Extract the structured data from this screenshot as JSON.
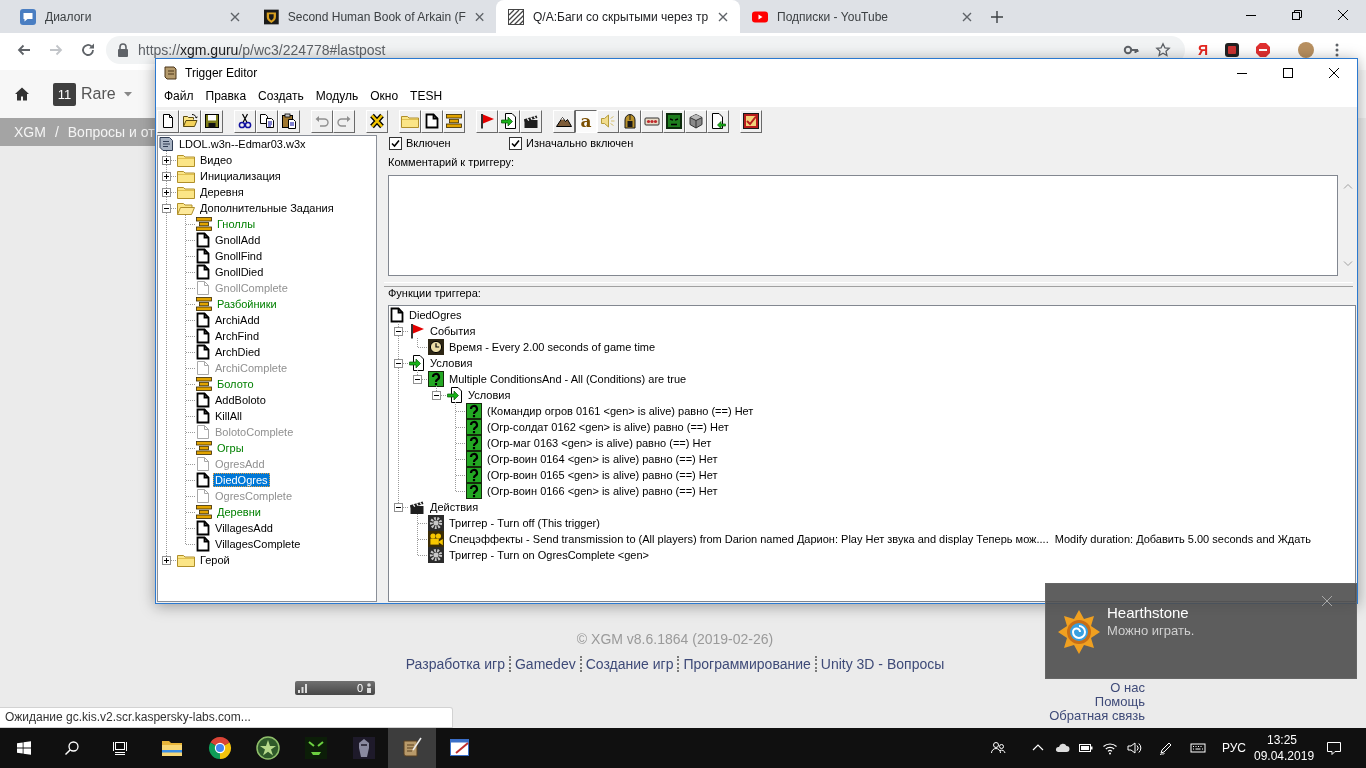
{
  "browser": {
    "tabs": [
      {
        "kind": "chat",
        "title": "Диалоги",
        "selected": false
      },
      {
        "kind": "shield",
        "title": "Second Human Book of Arkain (F",
        "selected": false
      },
      {
        "kind": "hatch",
        "title": "Q/A:Баги со скрытыми через тр",
        "selected": true
      },
      {
        "kind": "play",
        "title": "Подписки - YouTube",
        "selected": false
      }
    ],
    "address": {
      "scheme": "https://",
      "host": "xgm.guru",
      "path": "/p/wc3/224778#lastpost"
    },
    "extension_glyph": "Я"
  },
  "page": {
    "header": {
      "badge": "11",
      "rank": "Rare"
    },
    "breadcrumb": {
      "items": [
        "XGM",
        "Вопросы и от"
      ],
      "separator": "/"
    },
    "footer": {
      "copyright": "© XGM v8.6.1864 (2019-02-26)",
      "links": [
        "Разработка игр",
        "Gamedev",
        "Создание игр",
        "Программирование",
        "Unity 3D - Вопросы"
      ]
    },
    "counter": "0",
    "side_links": [
      "О нас",
      "Помощь",
      "Обратная связь"
    ],
    "status": "Ожидание gc.kis.v2.scr.kaspersky-labs.com..."
  },
  "trigger_editor": {
    "title": "Trigger Editor",
    "menu": [
      "Файл",
      "Правка",
      "Создать",
      "Модуль",
      "Окно",
      "TESH"
    ],
    "toolbar": [
      [
        {
          "kind": "new",
          "disabled": false,
          "pressed": false
        },
        {
          "kind": "open",
          "disabled": false,
          "pressed": false
        },
        {
          "kind": "save",
          "disabled": false,
          "pressed": false
        }
      ],
      [
        {
          "kind": "cut",
          "disabled": false,
          "pressed": false
        },
        {
          "kind": "copy",
          "disabled": false,
          "pressed": false
        },
        {
          "kind": "paste",
          "disabled": false,
          "pressed": false
        }
      ],
      [
        {
          "kind": "undo",
          "disabled": true,
          "pressed": false
        },
        {
          "kind": "redo",
          "disabled": true,
          "pressed": false
        }
      ],
      [
        {
          "kind": "delete",
          "disabled": false,
          "pressed": false
        }
      ],
      [
        {
          "kind": "folder",
          "disabled": false,
          "pressed": false
        },
        {
          "kind": "trigger",
          "disabled": false,
          "pressed": false
        },
        {
          "kind": "comment",
          "disabled": false,
          "pressed": false
        }
      ],
      [
        {
          "kind": "event",
          "disabled": false,
          "pressed": false
        },
        {
          "kind": "condition",
          "disabled": false,
          "pressed": false
        },
        {
          "kind": "action",
          "disabled": false,
          "pressed": false
        }
      ],
      [
        {
          "kind": "terrain",
          "disabled": false,
          "pressed": false
        },
        {
          "kind": "glyph",
          "glyph": "a",
          "disabled": false,
          "pressed": true
        },
        {
          "kind": "sound",
          "disabled": false,
          "pressed": false
        },
        {
          "kind": "unit",
          "disabled": false,
          "pressed": false
        },
        {
          "kind": "object",
          "disabled": false,
          "pressed": false
        },
        {
          "kind": "ai",
          "disabled": false,
          "pressed": false
        },
        {
          "kind": "cube",
          "disabled": false,
          "pressed": false
        },
        {
          "kind": "import",
          "disabled": false,
          "pressed": false
        }
      ],
      [
        {
          "kind": "test",
          "disabled": false,
          "pressed": false
        }
      ]
    ],
    "tree": {
      "kind": "map",
      "label": "LDOL.w3n--Edmar03.w3x",
      "selected": false,
      "children": [
        {
          "kind": "folder",
          "label": "Видео",
          "expanded": false,
          "selected": false
        },
        {
          "kind": "folder",
          "label": "Инициализация",
          "expanded": false,
          "selected": false
        },
        {
          "kind": "folder",
          "label": "Деревня",
          "expanded": false,
          "selected": false
        },
        {
          "kind": "folder",
          "label": "Дополнительные Задания",
          "expanded": true,
          "selected": false,
          "children": [
            {
              "kind": "comment",
              "label": "Гноллы",
              "disabled": false,
              "selected": false
            },
            {
              "kind": "trigger",
              "label": "GnollAdd",
              "disabled": false,
              "selected": false
            },
            {
              "kind": "trigger",
              "label": "GnollFind",
              "disabled": false,
              "selected": false
            },
            {
              "kind": "trigger",
              "label": "GnollDied",
              "disabled": false,
              "selected": false
            },
            {
              "kind": "trigger",
              "label": "GnollComplete",
              "disabled": true,
              "selected": false
            },
            {
              "kind": "comment",
              "label": "Разбойники",
              "disabled": false,
              "selected": false
            },
            {
              "kind": "trigger",
              "label": "ArchiAdd",
              "disabled": false,
              "selected": false
            },
            {
              "kind": "trigger",
              "label": "ArchFind",
              "disabled": false,
              "selected": false
            },
            {
              "kind": "trigger",
              "label": "ArchDied",
              "disabled": false,
              "selected": false
            },
            {
              "kind": "trigger",
              "label": "ArchiComplete",
              "disabled": true,
              "selected": false
            },
            {
              "kind": "comment",
              "label": "Болото",
              "disabled": false,
              "selected": false
            },
            {
              "kind": "trigger",
              "label": "AddBoloto",
              "disabled": false,
              "selected": false
            },
            {
              "kind": "trigger",
              "label": "KillAll",
              "disabled": false,
              "selected": false
            },
            {
              "kind": "trigger",
              "label": "BolotoComplete",
              "disabled": true,
              "selected": false
            },
            {
              "kind": "comment",
              "label": "Огры",
              "disabled": false,
              "selected": false
            },
            {
              "kind": "trigger",
              "label": "OgresAdd",
              "disabled": true,
              "selected": false
            },
            {
              "kind": "trigger",
              "label": "DiedOgres",
              "disabled": false,
              "selected": true
            },
            {
              "kind": "trigger",
              "label": "OgresComplete",
              "disabled": true,
              "selected": false
            },
            {
              "kind": "comment",
              "label": "Деревни",
              "disabled": false,
              "selected": false
            },
            {
              "kind": "trigger",
              "label": "VillagesAdd",
              "disabled": false,
              "selected": false
            },
            {
              "kind": "trigger",
              "label": "VillagesComplete",
              "disabled": false,
              "selected": false
            }
          ]
        },
        {
          "kind": "folder",
          "label": "Герой",
          "expanded": false,
          "selected": false
        }
      ]
    },
    "switches": [
      {
        "label": "Включен",
        "checked": true
      },
      {
        "label": "Изначально включен",
        "checked": true
      }
    ],
    "comment_label": "Комментарий к триггеру:",
    "functions_label": "Функции триггера:",
    "functions": {
      "kind": "trigger",
      "label": "DiedOgres",
      "children": [
        {
          "kind": "events",
          "label": "События",
          "expanded": true,
          "children": [
            {
              "kind": "timer",
              "label": "Время - Every 2.00 seconds of game time"
            }
          ]
        },
        {
          "kind": "conditions",
          "label": "Условия",
          "expanded": true,
          "children": [
            {
              "kind": "condition",
              "label": "Multiple ConditionsAnd - All (Conditions) are true",
              "expanded": true,
              "children": [
                {
                  "kind": "conditions",
                  "label": "Условия",
                  "expanded": true,
                  "children": [
                    {
                      "kind": "condition",
                      "label": "(Командир огров 0161 <gen> is alive) равно (==) Нет"
                    },
                    {
                      "kind": "condition",
                      "label": "(Огр-солдат 0162 <gen> is alive) равно (==) Нет"
                    },
                    {
                      "kind": "condition",
                      "label": "(Огр-маг 0163 <gen> is alive) равно (==) Нет"
                    },
                    {
                      "kind": "condition",
                      "label": "(Огр-воин 0164 <gen> is alive) равно (==) Нет"
                    },
                    {
                      "kind": "condition",
                      "label": "(Огр-воин 0165 <gen> is alive) равно (==) Нет"
                    },
                    {
                      "kind": "condition",
                      "label": "(Огр-воин 0166 <gen> is alive) равно (==) Нет"
                    }
                  ]
                }
              ]
            }
          ]
        },
        {
          "kind": "actions",
          "label": "Действия",
          "expanded": true,
          "children": [
            {
              "kind": "action",
              "label": "Триггер - Turn off (This trigger)"
            },
            {
              "kind": "cinematic",
              "label": "Спецэффекты - Send transmission to (All players) from Darion named Дарион: Play Нет звука and display Теперь мож....  Modify duration: Добавить 5.00 seconds and Ждать"
            },
            {
              "kind": "action",
              "label": "Триггер - Turn on OgresComplete <gen>"
            }
          ]
        }
      ]
    }
  },
  "notification": {
    "title": "Hearthstone",
    "message": "Можно играть."
  },
  "taskbar": {
    "apps": [
      {
        "kind": "folder",
        "selected": false
      },
      {
        "kind": "ring",
        "selected": false
      },
      {
        "kind": "emblem",
        "selected": false
      },
      {
        "kind": "monster",
        "selected": false
      },
      {
        "kind": "knight",
        "selected": false
      },
      {
        "kind": "scroll",
        "selected": true
      },
      {
        "kind": "painter",
        "selected": false
      }
    ],
    "language": "РУС",
    "time": "13:25",
    "date": "09.04.2019"
  }
}
